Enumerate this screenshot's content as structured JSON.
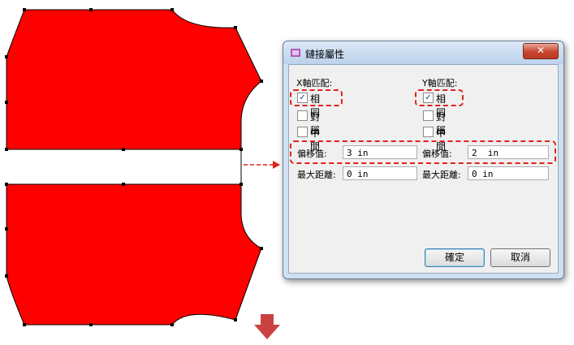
{
  "dialog": {
    "title": "鏈接屬性",
    "close_label": "✕",
    "x_group": {
      "header": "X軸匹配:",
      "same_label": "相同",
      "same_checked": true,
      "symmetric_label": "對稱",
      "symmetric_checked": false,
      "middle_label": "中間",
      "middle_checked": false,
      "offset_label": "偏移值:",
      "offset_value": "3 in",
      "maxdist_label": "最大距離:",
      "maxdist_value": "0 in"
    },
    "y_group": {
      "header": "Y軸匹配:",
      "same_label": "相同",
      "same_checked": true,
      "symmetric_label": "對稱",
      "symmetric_checked": false,
      "middle_label": "中間",
      "middle_checked": false,
      "offset_label": "偏移值:",
      "offset_value": "2  in",
      "maxdist_label": "最大距離:",
      "maxdist_value": "0 in"
    },
    "ok_label": "確定",
    "cancel_label": "取消"
  },
  "colors": {
    "pattern_fill": "#ff0000",
    "annotation_red": "#e1221b",
    "down_arrow": "#c9423f"
  }
}
